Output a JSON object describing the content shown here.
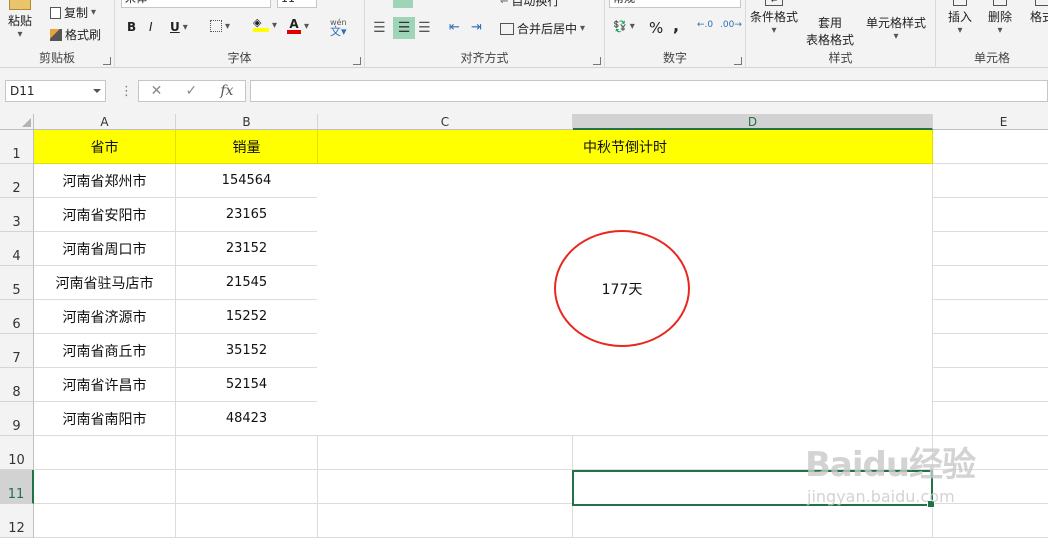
{
  "ribbon": {
    "clipboard": {
      "paste": "粘贴",
      "copy": "复制",
      "format_painter": "格式刷",
      "label": "剪贴板"
    },
    "font": {
      "font_name": "宋体",
      "font_size": "11",
      "bold": "B",
      "italic": "I",
      "underline": "U",
      "phonetic": "wén",
      "label": "字体"
    },
    "alignment": {
      "wrap_text": "自动换行",
      "merge_center": "合并后居中",
      "label": "对齐方式"
    },
    "number": {
      "format": "常规",
      "percent": "%",
      "comma": ",",
      "label": "数字"
    },
    "styles": {
      "conditional": "条件格式",
      "table_format_1": "套用",
      "table_format_2": "表格格式",
      "cell_styles": "单元格样式",
      "label": "样式"
    },
    "cells": {
      "insert": "插入",
      "delete": "删除",
      "format": "格式",
      "label": "单元格"
    }
  },
  "formula_bar": {
    "name_box": "D11",
    "cancel": "✕",
    "enter": "✓",
    "fx": "fx",
    "value": ""
  },
  "columns": [
    "A",
    "B",
    "C",
    "D",
    "E"
  ],
  "rows": [
    "1",
    "2",
    "3",
    "4",
    "5",
    "6",
    "7",
    "8",
    "9",
    "10",
    "11",
    "12"
  ],
  "selected": {
    "column": "D",
    "row": "11"
  },
  "table": {
    "header_province": "省市",
    "header_sales": "销量",
    "header_countdown": "中秋节倒计时",
    "data": [
      {
        "city": "河南省郑州市",
        "sales": "154564"
      },
      {
        "city": "河南省安阳市",
        "sales": "23165"
      },
      {
        "city": "河南省周口市",
        "sales": "23152"
      },
      {
        "city": "河南省驻马店市",
        "sales": "21545"
      },
      {
        "city": "河南省济源市",
        "sales": "15252"
      },
      {
        "city": "河南省商丘市",
        "sales": "35152"
      },
      {
        "city": "河南省许昌市",
        "sales": "52154"
      },
      {
        "city": "河南省南阳市",
        "sales": "48423"
      }
    ]
  },
  "countdown_value": "177天",
  "watermark": {
    "brand": "Baidu经验",
    "sub": "jingyan.baidu.com"
  },
  "colors": {
    "header_fill": "#ffff00",
    "circle": "#e8281e",
    "selection": "#217346"
  }
}
